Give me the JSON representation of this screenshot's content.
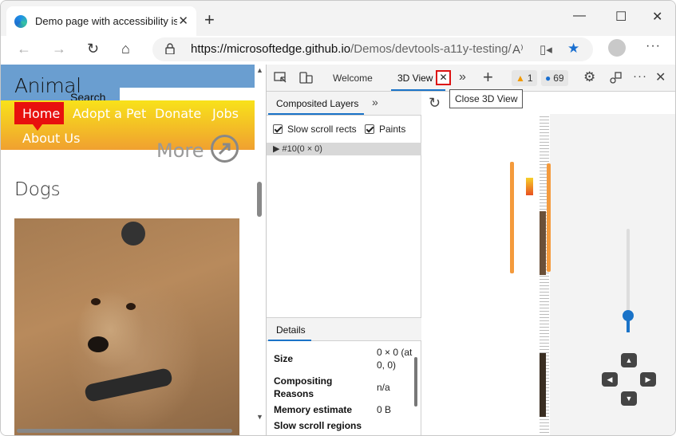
{
  "browser": {
    "tab_title": "Demo page with accessibility issu",
    "tab_close": "✕",
    "new_tab": "+",
    "window_controls": {
      "minimize": "—",
      "maximize": "☐",
      "close": "✕"
    },
    "nav": {
      "back": "←",
      "forward": "→",
      "refresh": "↻",
      "home": "⌂"
    },
    "address": {
      "host": "https://microsoftedge.github.io",
      "path": "/Demos/devtools-a11y-testing/"
    },
    "toolbar_icons": {
      "read_aloud": "A⁾",
      "immersive": "▯◂",
      "favorite": "★"
    },
    "more_menu": "···"
  },
  "page": {
    "title": "Animal",
    "search_label": "Search",
    "nav_items": [
      "Home",
      "Adopt a Pet",
      "Donate",
      "Jobs",
      "About Us"
    ],
    "more_text": "More",
    "section_title": "Dogs"
  },
  "devtools": {
    "toolbar": {
      "tabs": [
        "Welcome",
        "3D View"
      ],
      "more_tabs": "»",
      "add_tab": "+",
      "warnings_count": "1",
      "messages_count": "69",
      "close_tab": "✕"
    },
    "tooltip": "Close 3D View",
    "layers": {
      "tab": "Composited Layers",
      "more": "»",
      "checkboxes": [
        "Slow scroll rects",
        "Paints"
      ],
      "tree_item": "#10(0 × 0)",
      "details_tab": "Details",
      "details": [
        {
          "key": "Size",
          "value_l1": "0 × 0 (at",
          "value_l2": "0, 0)"
        },
        {
          "key_l1": "Compositing",
          "key_l2": "Reasons",
          "value": "n/a"
        },
        {
          "key": "Memory estimate",
          "value": "0 B"
        },
        {
          "key": "Slow scroll regions",
          "value": ""
        }
      ]
    },
    "view3d": {
      "refresh": "↻",
      "pad": {
        "up": "▲",
        "down": "▼",
        "left": "◀",
        "right": "▶"
      }
    }
  },
  "colors": {
    "accent": "#1a73c8",
    "header_blue": "#6a9ed0",
    "nav_red": "#e8100e",
    "highlight_red": "#dd1111",
    "layer_orange": "#f49a3c"
  }
}
